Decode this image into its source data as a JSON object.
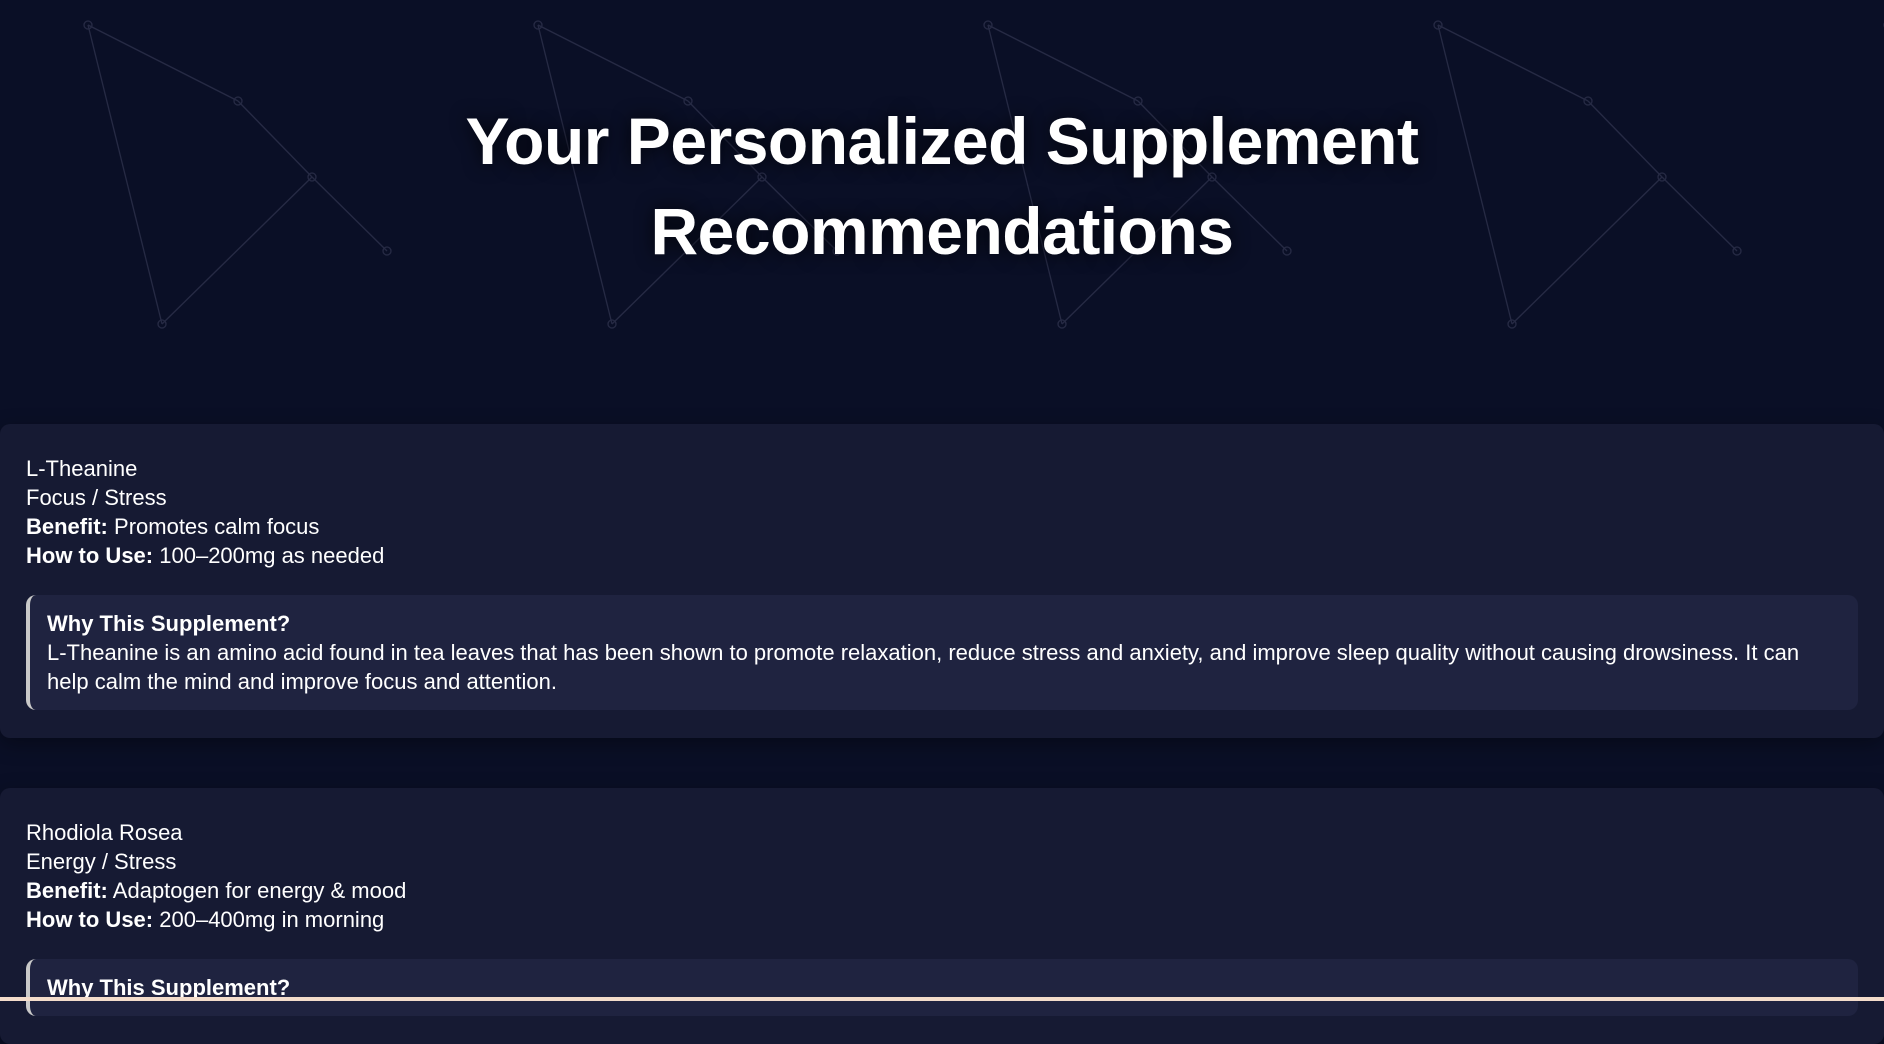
{
  "header": {
    "title": "Your Personalized Supplement Recommendations"
  },
  "colors": {
    "background": "#0a0f26",
    "card": "#161a33",
    "why_box": "#1f2340",
    "accent_border": "#c9c9c9"
  },
  "supplements": [
    {
      "name": "L-Theanine",
      "category": "Focus / Stress",
      "benefit_label": "Benefit:",
      "benefit": "Promotes calm focus",
      "usage_label": "How to Use:",
      "usage": "100–200mg as needed",
      "why_heading": "Why This Supplement?",
      "why_text": "L-Theanine is an amino acid found in tea leaves that has been shown to promote relaxation, reduce stress and anxiety, and improve sleep quality without causing drowsiness. It can help calm the mind and improve focus and attention."
    },
    {
      "name": "Rhodiola Rosea",
      "category": "Energy / Stress",
      "benefit_label": "Benefit:",
      "benefit": "Adaptogen for energy & mood",
      "usage_label": "How to Use:",
      "usage": "200–400mg in morning",
      "why_heading": "Why This Supplement?"
    }
  ]
}
